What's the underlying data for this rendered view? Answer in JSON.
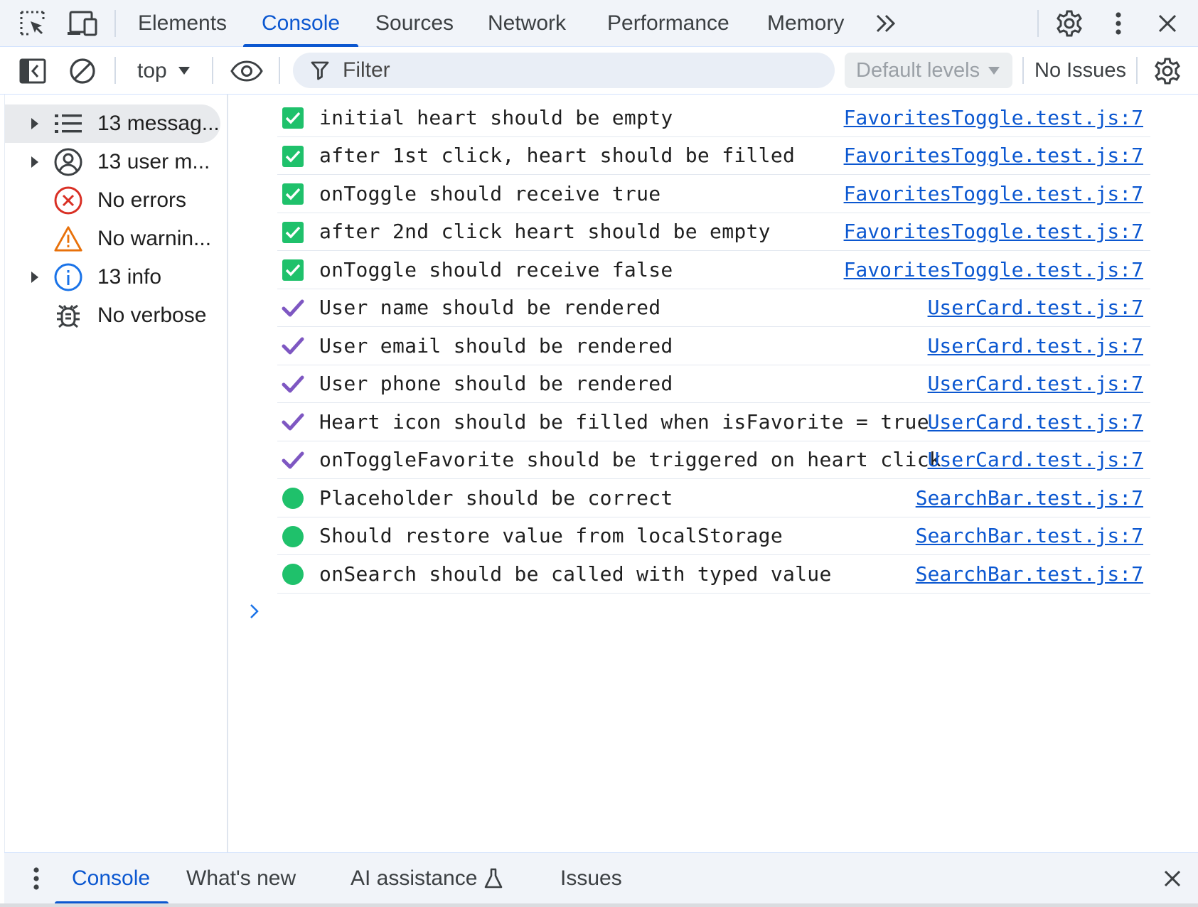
{
  "topbar": {
    "tabs": [
      "Elements",
      "Console",
      "Sources",
      "Network",
      "Performance",
      "Memory"
    ],
    "active_tab": "Console",
    "icons": [
      "inspect-element-icon",
      "device-toolbar-icon",
      "more-tabs-icon",
      "settings-icon",
      "more-options-icon",
      "close-icon"
    ]
  },
  "toolbar": {
    "context": "top",
    "filter_placeholder": "Filter",
    "levels": "Default levels",
    "issues": "No Issues"
  },
  "sidebar": {
    "items": [
      {
        "label": "13 messag...",
        "icon": "list-icon",
        "expandable": true,
        "selected": true
      },
      {
        "label": "13 user m...",
        "icon": "user-icon",
        "expandable": true,
        "selected": false
      },
      {
        "label": "No errors",
        "icon": "error-icon",
        "expandable": false,
        "selected": false
      },
      {
        "label": "No warnin...",
        "icon": "warning-icon",
        "expandable": false,
        "selected": false
      },
      {
        "label": "13 info",
        "icon": "info-icon",
        "expandable": true,
        "selected": false
      },
      {
        "label": "No verbose",
        "icon": "bug-icon",
        "expandable": false,
        "selected": false
      }
    ]
  },
  "messages": [
    {
      "marker": "checkbox",
      "text": "initial heart should be empty",
      "source": "FavoritesToggle.test.js:7"
    },
    {
      "marker": "checkbox",
      "text": "after 1st click, heart should be filled",
      "source": "FavoritesToggle.test.js:7"
    },
    {
      "marker": "checkbox",
      "text": "onToggle should receive true",
      "source": "FavoritesToggle.test.js:7"
    },
    {
      "marker": "checkbox",
      "text": "after 2nd click heart should be empty",
      "source": "FavoritesToggle.test.js:7"
    },
    {
      "marker": "checkbox",
      "text": "onToggle should receive false",
      "source": "FavoritesToggle.test.js:7"
    },
    {
      "marker": "checkmark",
      "text": "User name should be rendered",
      "source": "UserCard.test.js:7"
    },
    {
      "marker": "checkmark",
      "text": "User email should be rendered",
      "source": "UserCard.test.js:7"
    },
    {
      "marker": "checkmark",
      "text": "User phone should be rendered",
      "source": "UserCard.test.js:7"
    },
    {
      "marker": "checkmark",
      "text": "Heart icon should be filled when isFavorite = true",
      "source": "UserCard.test.js:7"
    },
    {
      "marker": "checkmark",
      "text": "onToggleFavorite should be triggered on heart click",
      "source": "UserCard.test.js:7"
    },
    {
      "marker": "dot",
      "text": "Placeholder should be correct",
      "source": "SearchBar.test.js:7"
    },
    {
      "marker": "dot",
      "text": "Should restore value from localStorage",
      "source": "SearchBar.test.js:7"
    },
    {
      "marker": "dot",
      "text": "onSearch should be called with typed value",
      "source": "SearchBar.test.js:7"
    }
  ],
  "drawer": {
    "tabs": [
      "Console",
      "What's new",
      "AI assistance",
      "Issues"
    ],
    "active_tab": "Console"
  },
  "colors": {
    "accent": "#0b57d0",
    "check_green": "#1fc16b",
    "check_purple": "#7e57c2",
    "error_red": "#d93025",
    "warning_orange": "#e8710a",
    "info_blue": "#1a73e8"
  }
}
